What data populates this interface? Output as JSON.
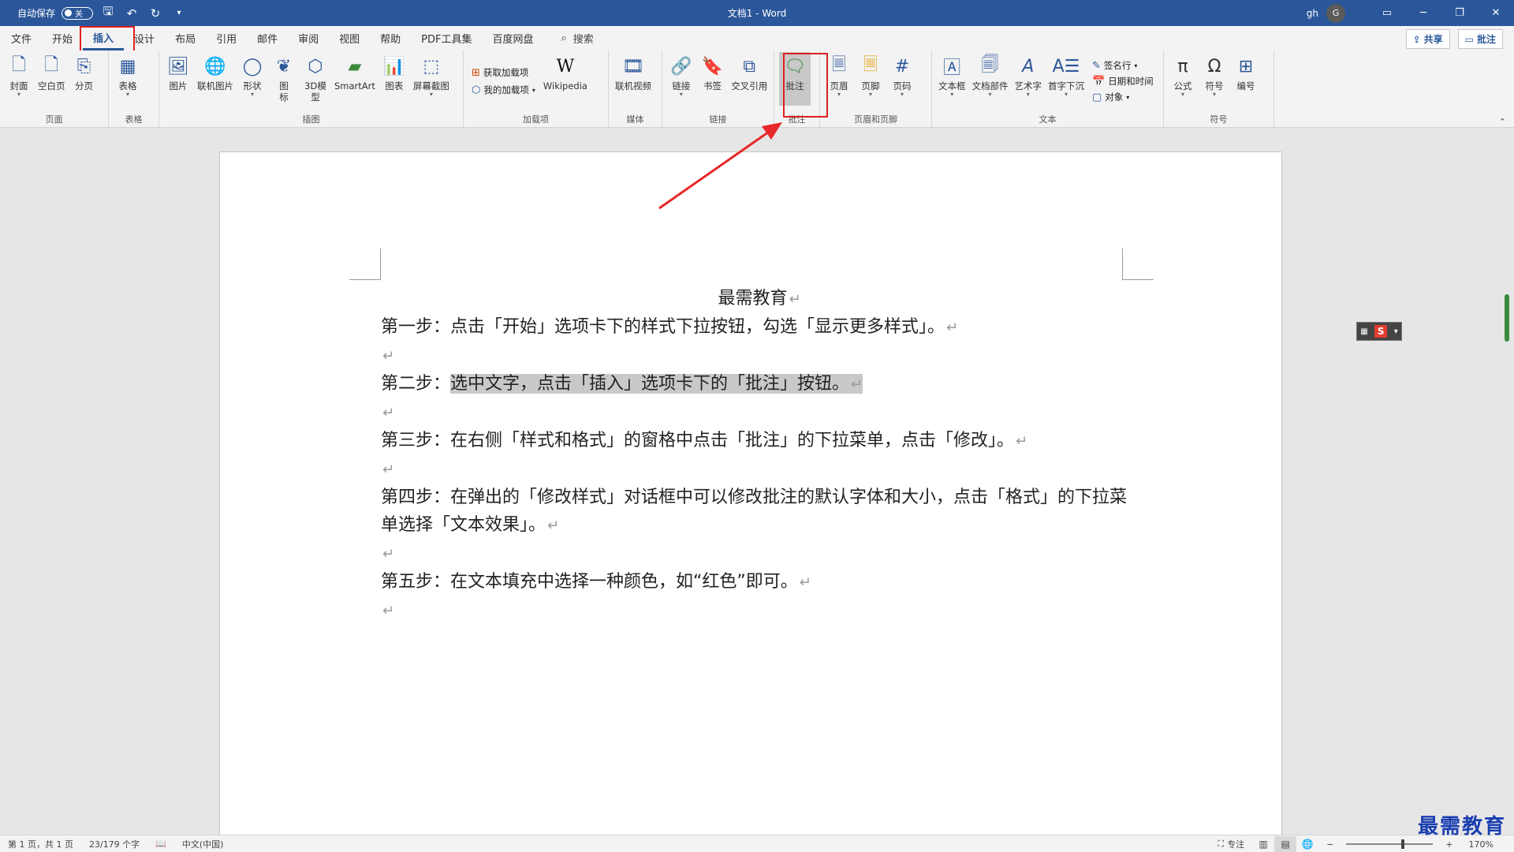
{
  "titlebar": {
    "autosave_label": "自动保存",
    "autosave_state": "关",
    "doc_title": "文档1 - Word",
    "user_name": "gh",
    "user_initial": "G"
  },
  "menu": {
    "tabs": [
      "文件",
      "开始",
      "插入",
      "设计",
      "布局",
      "引用",
      "邮件",
      "审阅",
      "视图",
      "帮助",
      "PDF工具集",
      "百度网盘"
    ],
    "search_label": "搜索",
    "share_label": "共享",
    "comments_label": "批注"
  },
  "ribbon": {
    "page": {
      "label": "页面",
      "cover": "封面",
      "blank": "空白页",
      "break": "分页"
    },
    "table": {
      "label": "表格",
      "table": "表格"
    },
    "illustrations": {
      "label": "插图",
      "picture": "图片",
      "online_picture": "联机图片",
      "shapes": "形状",
      "icons": "图标",
      "model3d": "3D模型",
      "smartart": "SmartArt",
      "chart": "图表",
      "screenshot": "屏幕截图"
    },
    "addins": {
      "label": "加载项",
      "get": "获取加载项",
      "my": "我的加载项",
      "wikipedia": "Wikipedia"
    },
    "media": {
      "label": "媒体",
      "online_video": "联机视频"
    },
    "links": {
      "label": "链接",
      "link": "链接",
      "bookmark": "书签",
      "cross_ref": "交叉引用"
    },
    "comments": {
      "label": "批注",
      "comment": "批注"
    },
    "header_footer": {
      "label": "页眉和页脚",
      "header": "页眉",
      "footer": "页脚",
      "page_number": "页码"
    },
    "text": {
      "label": "文本",
      "textbox": "文本框",
      "quick_parts": "文档部件",
      "wordart": "艺术字",
      "dropcap": "首字下沉",
      "signature": "签名行",
      "datetime": "日期和时间",
      "object": "对象"
    },
    "symbols": {
      "label": "符号",
      "equation": "公式",
      "symbol": "符号",
      "numbering": "编号"
    }
  },
  "document": {
    "title": "最需教育",
    "step1": "第一步：点击「开始」选项卡下的样式下拉按钮，勾选「显示更多样式」。",
    "step2_prefix": "第二步：",
    "step2_selected": "选中文字，点击「插入」选项卡下的「批注」按钮。",
    "step3": "第三步：在右侧「样式和格式」的窗格中点击「批注」的下拉菜单，点击「修改」。",
    "step4": "第四步：在弹出的「修改样式」对话框中可以修改批注的默认字体和大小，点击「格式」的下拉菜单选择「文本效果」。",
    "step5": "第五步：在文本填充中选择一种颜色，如“红色”即可。",
    "para_mark": "↵"
  },
  "statusbar": {
    "page": "第 1 页，共 1 页",
    "words": "23/179 个字",
    "language": "中文(中国)",
    "focus": "专注",
    "zoom": "170%"
  },
  "watermark": "最需教育",
  "colors": {
    "accent": "#2b579a",
    "highlight": "#e02020",
    "selection": "#c9c9c9"
  }
}
